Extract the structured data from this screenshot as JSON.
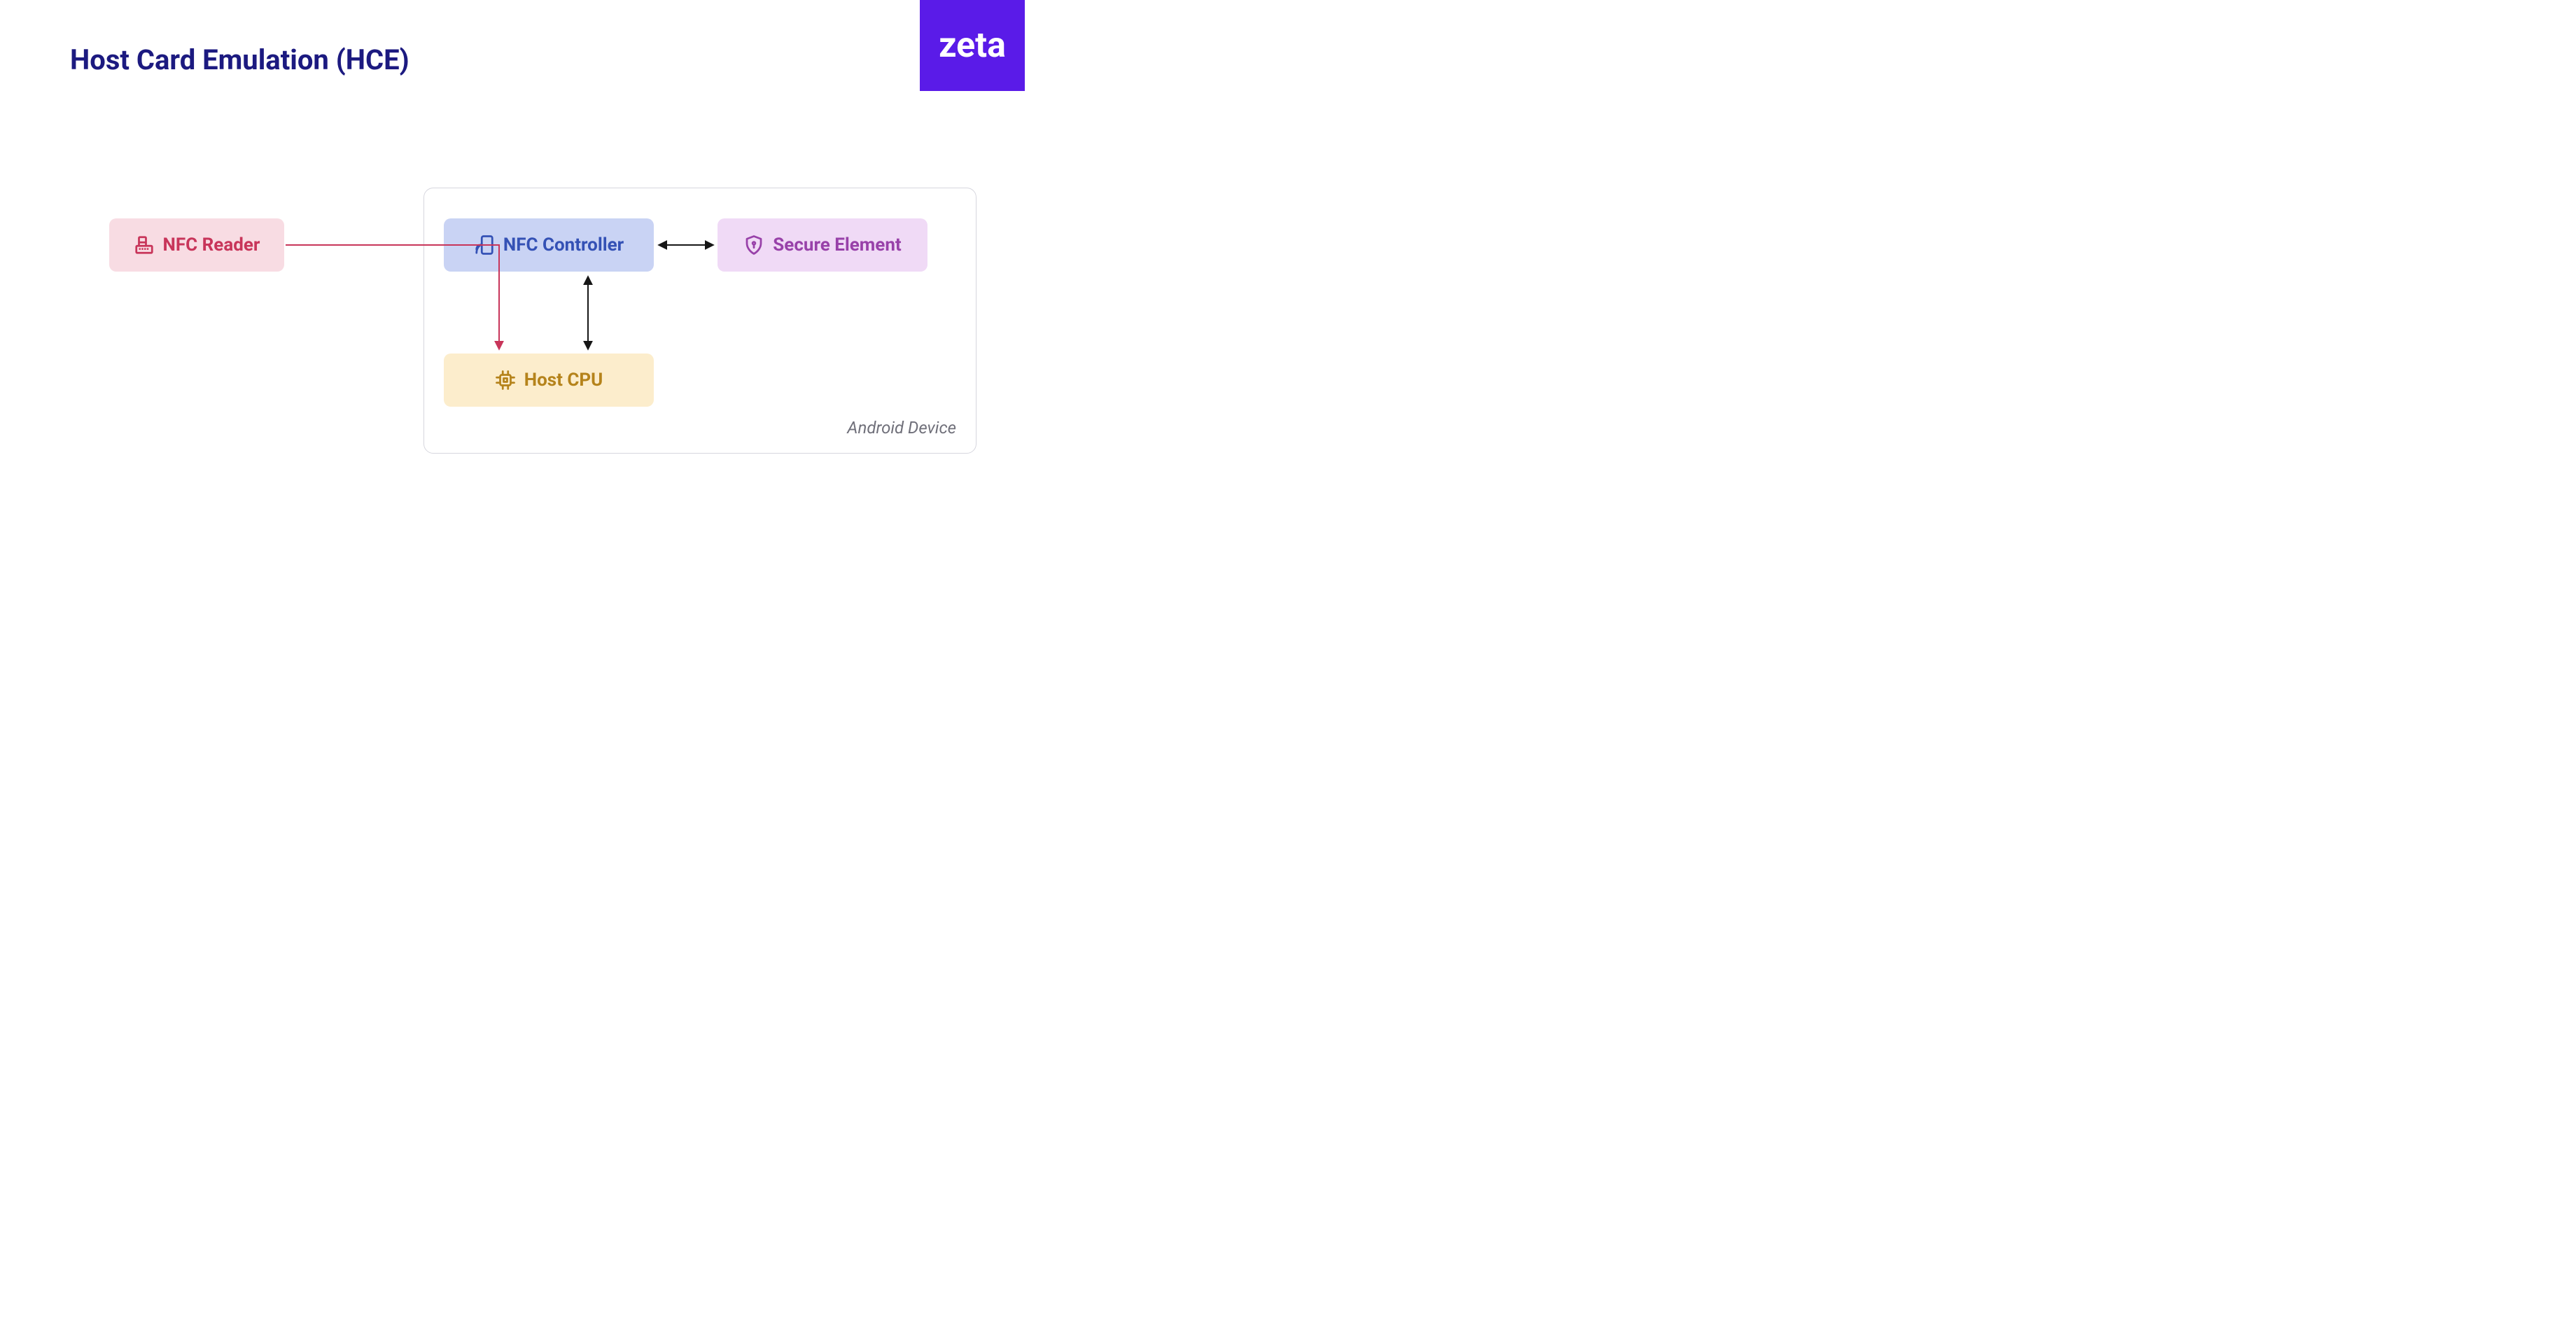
{
  "title": "Host Card Emulation (HCE)",
  "logo": {
    "text": "zeta"
  },
  "device": {
    "label": "Android Device"
  },
  "nodes": {
    "nfc_reader": {
      "label": "NFC Reader",
      "icon": "cash-register-icon"
    },
    "nfc_controller": {
      "label": "NFC Controller",
      "icon": "phone-nfc-icon"
    },
    "secure_element": {
      "label": "Secure Element",
      "icon": "shield-lock-icon"
    },
    "host_cpu": {
      "label": "Host CPU",
      "icon": "cpu-chip-icon"
    }
  },
  "connections": [
    {
      "from": "nfc_reader",
      "to": "host_cpu",
      "style": "red-one-way"
    },
    {
      "from": "nfc_controller",
      "to": "secure_element",
      "style": "black-two-way"
    },
    {
      "from": "nfc_controller",
      "to": "host_cpu",
      "style": "black-two-way"
    }
  ],
  "colors": {
    "title": "#1c1a80",
    "logo_bg": "#5a1be8",
    "nfc_reader_bg": "#f8dce3",
    "nfc_reader_fg": "#c8355a",
    "nfc_controller_bg": "#c9d3f4",
    "nfc_controller_fg": "#3451b5",
    "secure_element_bg": "#f0daf6",
    "secure_element_fg": "#9841a9",
    "host_cpu_bg": "#fcedcc",
    "host_cpu_fg": "#b5831b",
    "arrow_red": "#c8355a",
    "arrow_black": "#161616"
  }
}
